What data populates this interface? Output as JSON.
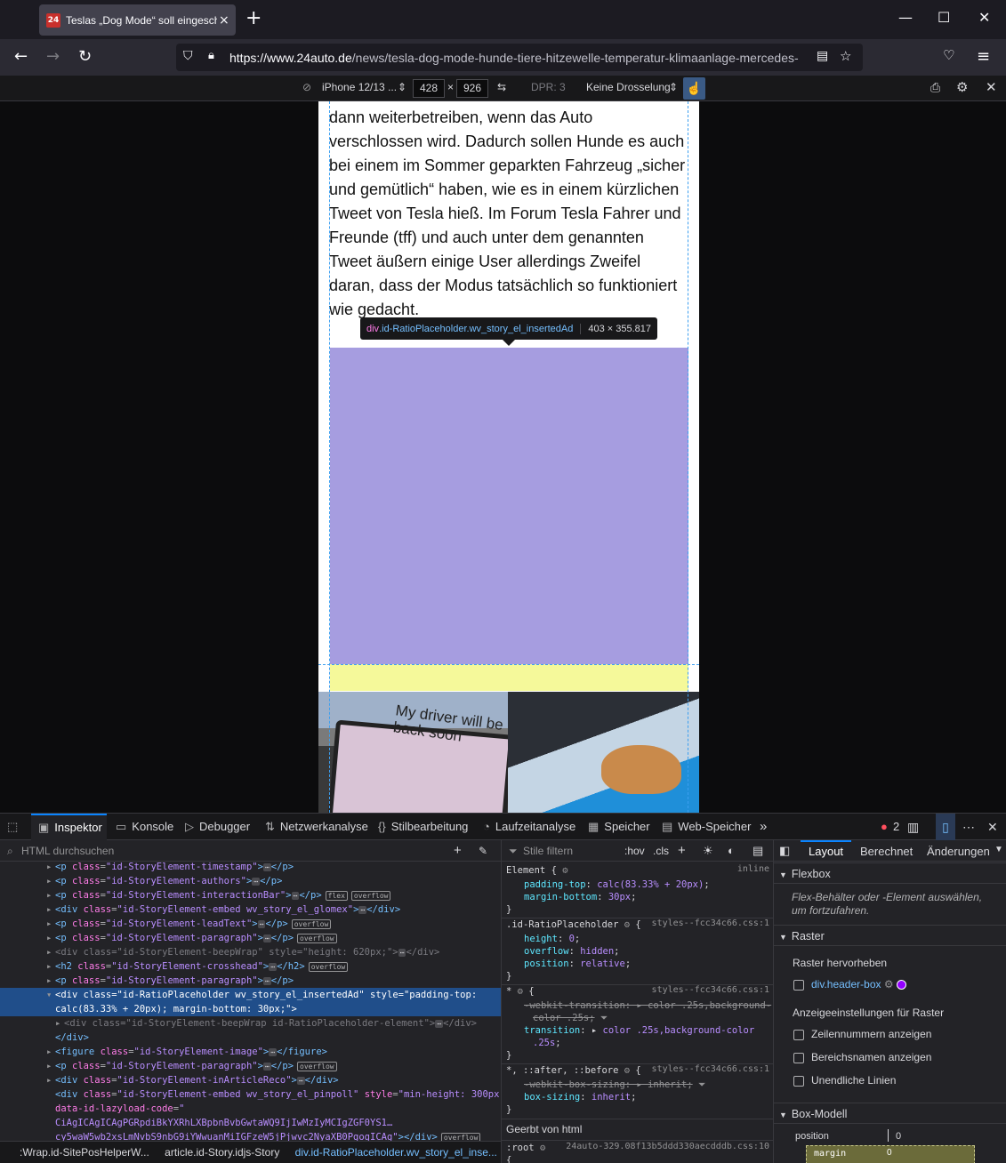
{
  "browser": {
    "tab_title": "Teslas „Dog Mode“ soll eingeschaltet",
    "tab_close": "×",
    "new_tab": "+",
    "url_host": "https://www.24auto.de",
    "url_path": "/news/tesla-dog-mode-hunde-tiere-hitzewelle-temperatur-klimaanlage-mercedes-",
    "win_minimize": "—",
    "win_maximize": "☐",
    "win_close": "✕"
  },
  "rdm": {
    "device": "iPhone 12/13 ...",
    "width": "428",
    "times": "×",
    "height": "926",
    "dpr": "DPR: 3",
    "throttle": "Keine Drosselung"
  },
  "article": {
    "paragraph": "dann weiterbetreiben, wenn das Auto verschlossen wird. Dadurch sollen Hunde es auch bei einem im Sommer geparkten Fahrzeug „sicher und gemütlich“ haben, wie es in einem kürzlichen Tweet von Tesla hieß. Im Forum Tesla Fahrer und Freunde (tff) und auch unter dem genannten Tweet äußern einige User allerdings Zweifel daran, dass der Modus tatsächlich so funktioniert wie gedacht.",
    "image_text": "My driver will be back soon"
  },
  "tooltip": {
    "tag": "div",
    "classes": ".id-RatioPlaceholder.wv_story_el_insertedAd",
    "dimensions": "403 × 355.817"
  },
  "devtools": {
    "tabs": [
      "Inspektor",
      "Konsole",
      "Debugger",
      "Netzwerkanalyse",
      "Stilbearbeitung",
      "Laufzeitanalyse",
      "Speicher",
      "Web-Speicher"
    ],
    "error_count": "2",
    "search_placeholder": "HTML durchsuchen",
    "rules_filter_placeholder": "Stile filtern",
    "hov": ":hov",
    "cls": ".cls",
    "breadcrumbs": [
      ":Wrap.id-SitePosHelperW...",
      "article.id-Story.idjs-Story",
      "div.id-RatioPlaceholder.wv_story_el_inse..."
    ],
    "layout_tabs": [
      "Layout",
      "Berechnet",
      "Änderungen"
    ],
    "flexbox_title": "Flexbox",
    "flexbox_hint": "Flex-Behälter oder -Element auswählen, um fortzufahren.",
    "raster_title": "Raster",
    "raster_highlight": "Raster hervorheben",
    "raster_item": "div.header-box",
    "raster_display": "Anzeigeeinstellungen für Raster",
    "raster_options": [
      "Zeilennummern anzeigen",
      "Bereichsnamen anzeigen",
      "Unendliche Linien"
    ],
    "boxmodel_title": "Box-Modell",
    "position_label": "position",
    "position_value": "0",
    "margin_label": "margin",
    "margin_value": "0"
  },
  "colors": {
    "ad_highlight": "#a69de0",
    "margin_highlight": "#f5f99a",
    "selection": "#204e8a",
    "accent": "#0a84ff"
  }
}
